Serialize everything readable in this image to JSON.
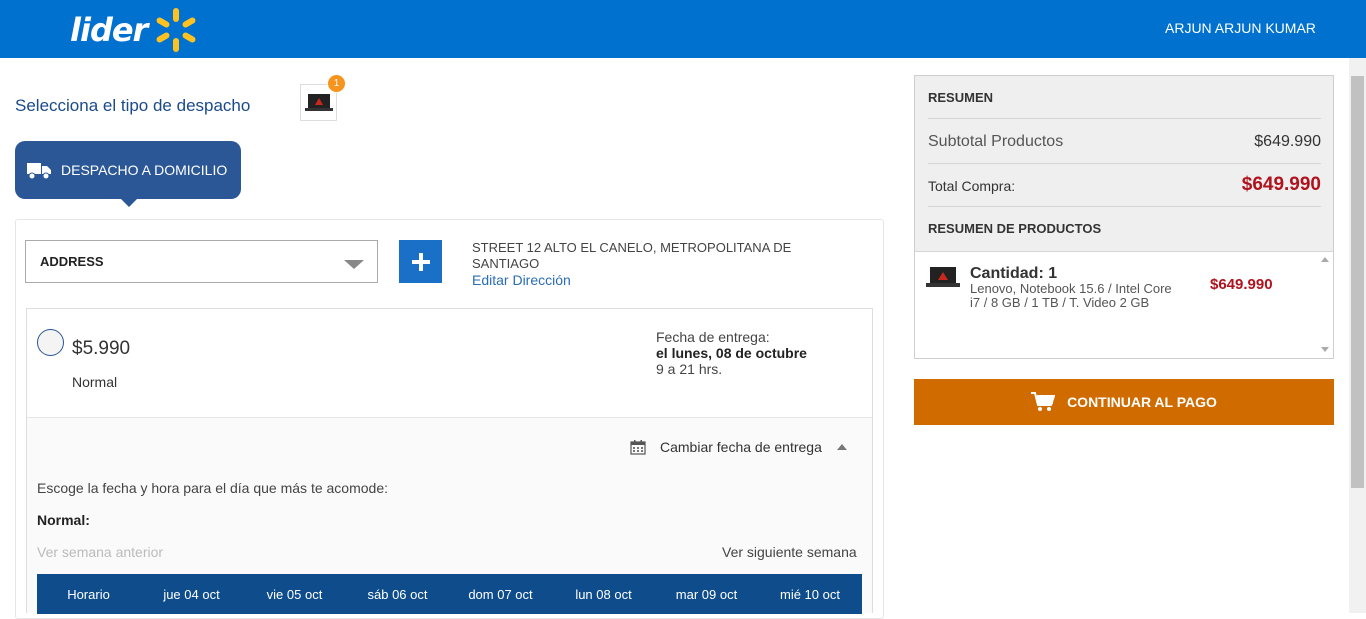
{
  "header": {
    "logo_text": "lider",
    "user_name": "ARJUN  ARJUN KUMAR"
  },
  "shipping": {
    "title": "Selecciona el tipo de despacho",
    "cart_count": "1",
    "tab_label": "DESPACHO A DOMICILIO",
    "address_select": "ADDRESS",
    "address_text": "STREET 12 ALTO EL CANELO, METROPOLITANA DE SANTIAGO",
    "edit_link": "Editar Dirección"
  },
  "option": {
    "price": "$5.990",
    "name": "Normal",
    "delivery_label": "Fecha de entrega:",
    "delivery_date": "el lunes, 08 de octubre",
    "delivery_hours": "9 a 21 hrs.",
    "change_date": "Cambiar fecha de entrega",
    "instruction": "Escoge la fecha y hora para el día que más te acomode:",
    "normal_head": "Normal:",
    "prev_week": "Ver semana anterior",
    "next_week": "Ver siguiente semana",
    "schedule_headers": [
      "Horario",
      "jue 04 oct",
      "vie 05 oct",
      "sáb 06 oct",
      "dom 07 oct",
      "lun 08 oct",
      "mar 09 oct",
      "mié 10 oct"
    ]
  },
  "summary": {
    "title": "RESUMEN",
    "subtotal_label": "Subtotal Productos",
    "subtotal_value": "$649.990",
    "total_label": "Total Compra:",
    "total_value": "$649.990",
    "products_title": "RESUMEN DE PRODUCTOS",
    "product": {
      "quantity": "Cantidad: 1",
      "description": "Lenovo, Notebook 15.6 / Intel Core i7 / 8 GB / 1 TB / T. Video 2 GB",
      "price": "$649.990"
    }
  },
  "checkout": {
    "button_label": "CONTINUAR AL PAGO"
  },
  "colors": {
    "brand_blue": "#0071ce",
    "accent_yellow": "#ffc220",
    "pay_orange": "#d06b00",
    "price_red": "#b0131d"
  }
}
